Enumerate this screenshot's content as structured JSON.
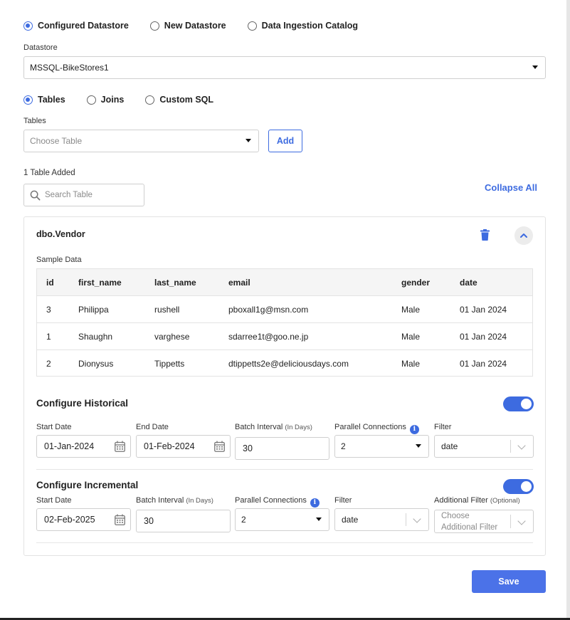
{
  "source_options": [
    {
      "label": "Configured Datastore",
      "selected": true
    },
    {
      "label": "New Datastore",
      "selected": false
    },
    {
      "label": "Data Ingestion Catalog",
      "selected": false
    }
  ],
  "datastore": {
    "label": "Datastore",
    "value": "MSSQL-BikeStores1"
  },
  "query_modes": [
    {
      "label": "Tables",
      "selected": true
    },
    {
      "label": "Joins",
      "selected": false
    },
    {
      "label": "Custom SQL",
      "selected": false
    }
  ],
  "tables": {
    "label": "Tables",
    "placeholder": "Choose Table",
    "add_label": "Add"
  },
  "added_count_text": "1 Table Added",
  "search": {
    "placeholder": "Search Table",
    "icon": "search-icon"
  },
  "collapse_all_label": "Collapse All",
  "table_card": {
    "name": "dbo.Vendor",
    "sample_label": "Sample Data",
    "columns": [
      "id",
      "first_name",
      "last_name",
      "email",
      "gender",
      "date"
    ],
    "rows": [
      [
        "3",
        "Philippa",
        "rushell",
        "pboxall1g@msn.com",
        "Male",
        "01 Jan 2024"
      ],
      [
        "1",
        "Shaughn",
        "varghese",
        "sdarree1t@goo.ne.jp",
        "Male",
        "01 Jan 2024"
      ],
      [
        "2",
        "Dionysus",
        "Tippetts",
        "dtippetts2e@deliciousdays.com",
        "Male",
        "01 Jan 2024"
      ]
    ]
  },
  "historical": {
    "title": "Configure Historical",
    "enabled": true,
    "start_date_label": "Start Date",
    "start_date": "01-Jan-2024",
    "end_date_label": "End Date",
    "end_date": "01-Feb-2024",
    "batch_label": "Batch Interval",
    "batch_unit": "(In Days)",
    "batch_value": "30",
    "parallel_label": "Parallel Connections",
    "parallel_value": "2",
    "filter_label": "Filter",
    "filter_value": "date"
  },
  "incremental": {
    "title": "Configure Incremental",
    "enabled": true,
    "start_date_label": "Start Date",
    "start_date": "02-Feb-2025",
    "batch_label": "Batch Interval",
    "batch_unit": "(In Days)",
    "batch_value": "30",
    "parallel_label": "Parallel Connections",
    "parallel_value": "2",
    "filter_label": "Filter",
    "filter_value": "date",
    "additional_filter_label": "Additional Filter",
    "additional_filter_note": "(Optional)",
    "additional_filter_placeholder_1": "Choose",
    "additional_filter_placeholder_2": "Additional Filter"
  },
  "save_label": "Save",
  "info_glyph": "i",
  "colors": {
    "accent": "#3d6be0",
    "primary_button": "#4b72e8"
  }
}
